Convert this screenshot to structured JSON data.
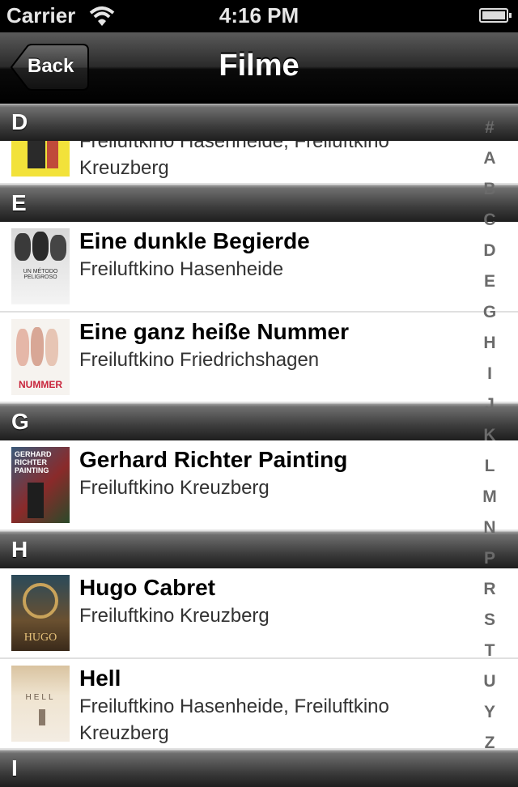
{
  "status_bar": {
    "carrier": "Carrier",
    "time": "4:16 PM"
  },
  "nav_bar": {
    "back_label": "Back",
    "title": "Filme"
  },
  "sections": [
    "D",
    "E",
    "G",
    "H",
    "I"
  ],
  "rows": [
    {
      "title": "",
      "subtitle": "Freiluftkino Hasenheide, Freiluftkino Kreuzberg"
    },
    {
      "title": "Eine dunkle Begierde",
      "subtitle": "Freiluftkino Hasenheide",
      "poster_text": "UN MÉTODO PELIGROSO"
    },
    {
      "title": "Eine ganz heiße Nummer",
      "subtitle": "Freiluftkino Friedrichshagen",
      "poster_text": "NUMMER"
    },
    {
      "title": "Gerhard Richter Painting",
      "subtitle": "Freiluftkino Kreuzberg",
      "poster_text": "GERHARD RICHTER PAINTING"
    },
    {
      "title": "Hugo Cabret",
      "subtitle": "Freiluftkino Kreuzberg",
      "poster_text": "HUGO"
    },
    {
      "title": "Hell",
      "subtitle": "Freiluftkino Hasenheide, Freiluftkino Kreuzberg",
      "poster_text": "HELL"
    }
  ],
  "index": [
    "#",
    "A",
    "B",
    "C",
    "D",
    "E",
    "G",
    "H",
    "I",
    "J",
    "K",
    "L",
    "M",
    "N",
    "P",
    "R",
    "S",
    "T",
    "U",
    "Y",
    "Z"
  ],
  "colors": {
    "status_bar": "#000000",
    "section_header": "#3c3c3c",
    "index_text": "#6b6b6b"
  },
  "icons": {
    "wifi": "wifi-icon",
    "battery": "battery-icon",
    "back": "back-chevron"
  }
}
